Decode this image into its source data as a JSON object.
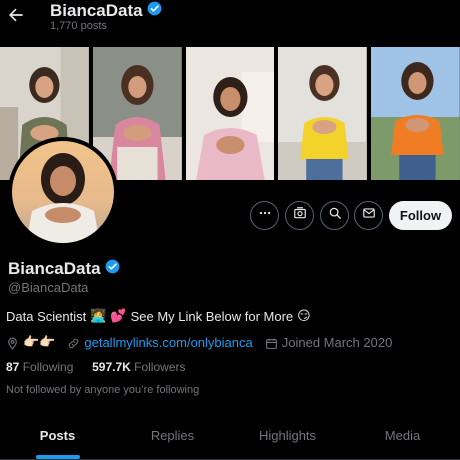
{
  "header": {
    "title": "BiancaData",
    "post_count": "1,770 posts"
  },
  "profile": {
    "display_name": "BiancaData",
    "handle": "@BiancaData",
    "bio": {
      "text_1": "Data Scientist",
      "emoji_1": "👩‍💻",
      "emoji_2": "💕",
      "text_2": "See My Link Below for More",
      "emoji_3": "😏"
    },
    "location_emoji": "👉🏻👉🏻",
    "link": "getallmylinks.com/onlybianca",
    "joined": "Joined March 2020",
    "following_count": "87",
    "following_label": "Following",
    "followers_count": "597.7K",
    "followers_label": "Followers",
    "not_followed_text": "Not followed by anyone you’re following"
  },
  "actions": {
    "follow_label": "Follow"
  },
  "tabs": [
    {
      "label": "Posts",
      "active": true
    },
    {
      "label": "Replies",
      "active": false
    },
    {
      "label": "Highlights",
      "active": false
    },
    {
      "label": "Media",
      "active": false
    }
  ],
  "colors": {
    "accent": "#1d9bf0",
    "background": "#000000",
    "muted": "#71767b",
    "text": "#e7e9ea"
  },
  "icons": [
    "back-arrow-icon",
    "verified-badge-icon",
    "more-icon",
    "subscribe-icon",
    "search-icon",
    "message-icon",
    "location-icon",
    "link-icon",
    "calendar-icon"
  ]
}
